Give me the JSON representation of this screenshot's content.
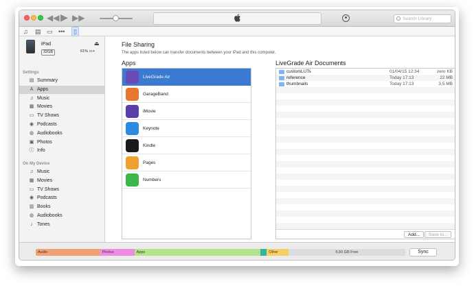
{
  "toolbar": {
    "search_placeholder": "Search Library"
  },
  "device": {
    "name": "iPad",
    "capacity": "32GB",
    "battery": "61%"
  },
  "sidebar": {
    "settings_header": "Settings",
    "settings": [
      {
        "label": "Summary",
        "icon": "summary-icon"
      },
      {
        "label": "Apps",
        "icon": "apps-icon"
      },
      {
        "label": "Music",
        "icon": "music-icon"
      },
      {
        "label": "Movies",
        "icon": "movies-icon"
      },
      {
        "label": "TV Shows",
        "icon": "tv-icon"
      },
      {
        "label": "Podcasts",
        "icon": "podcasts-icon"
      },
      {
        "label": "Audiobooks",
        "icon": "audiobooks-icon"
      },
      {
        "label": "Photos",
        "icon": "photos-icon"
      },
      {
        "label": "Info",
        "icon": "info-icon"
      }
    ],
    "ondevice_header": "On My Device",
    "ondevice": [
      {
        "label": "Music",
        "icon": "music-icon"
      },
      {
        "label": "Movies",
        "icon": "movies-icon"
      },
      {
        "label": "TV Shows",
        "icon": "tv-icon"
      },
      {
        "label": "Podcasts",
        "icon": "podcasts-icon"
      },
      {
        "label": "Books",
        "icon": "books-icon"
      },
      {
        "label": "Audiobooks",
        "icon": "audiobooks-icon"
      },
      {
        "label": "Tones",
        "icon": "tones-icon"
      }
    ]
  },
  "main": {
    "title": "File Sharing",
    "description": "The apps listed below can transfer documents between your iPad and this computer.",
    "apps_title": "Apps",
    "apps": [
      {
        "name": "LiveGrade Air",
        "color": "#6a4bb5"
      },
      {
        "name": "GarageBand",
        "color": "#e8762c"
      },
      {
        "name": "iMovie",
        "color": "#5a3fa8"
      },
      {
        "name": "Keynote",
        "color": "#2c8be0"
      },
      {
        "name": "Kindle",
        "color": "#1a1a1a"
      },
      {
        "name": "Pages",
        "color": "#f0a030"
      },
      {
        "name": "Numbers",
        "color": "#3db64a"
      }
    ],
    "docs_title": "LiveGrade Air Documents",
    "documents": [
      {
        "name": "customLUTs",
        "date": "01/04/15 12:34",
        "size": "zero KB"
      },
      {
        "name": "reference",
        "date": "Today 17:13",
        "size": "22 MB"
      },
      {
        "name": "thumbnails",
        "date": "Today 17:13",
        "size": "3,5 MB"
      }
    ],
    "add_label": "Add...",
    "save_label": "Save to..."
  },
  "capacity": {
    "segments": [
      {
        "label": "Audio",
        "color": "#f2a175",
        "fraction": 0.174
      },
      {
        "label": "Photos",
        "color": "#ef8de6",
        "fraction": 0.093
      },
      {
        "label": "Apps",
        "color": "#b3e48a",
        "fraction": 0.34
      },
      {
        "label": "",
        "color": "#2fb5a0",
        "fraction": 0.018
      },
      {
        "label": "Other",
        "color": "#f6d061",
        "fraction": 0.059
      },
      {
        "label": "6,50 GB Free",
        "color": "#dcdcdc",
        "fraction": 0.316
      }
    ],
    "sync_label": "Sync"
  }
}
